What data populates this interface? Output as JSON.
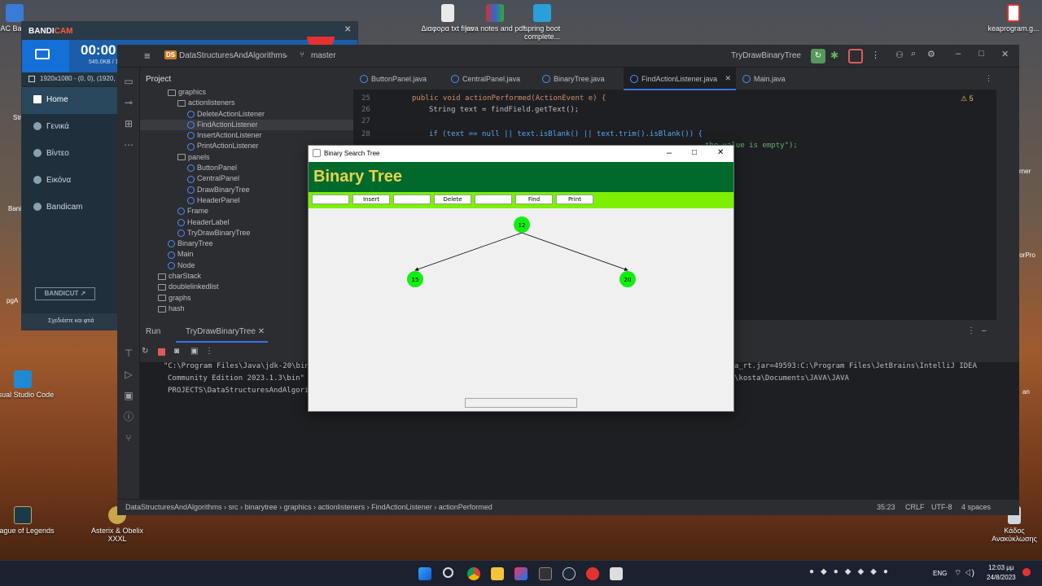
{
  "desktop": {
    "icons": [
      {
        "label": "AC Back"
      },
      {
        "label": "Διαφορα txt files"
      },
      {
        "label": "java notes and pdf"
      },
      {
        "label": "spring boot complete..."
      },
      {
        "label": "keaprogram.g..."
      },
      {
        "label": "Visual Studio Code"
      },
      {
        "label": "League of Legends"
      },
      {
        "label": "Asterix & Obelix XXXL"
      },
      {
        "label": "Κάδος Ανακύκλωσης"
      }
    ],
    "edge_labels": [
      "Str",
      "Bani",
      "pgA",
      "rner",
      "torPro",
      "an"
    ]
  },
  "bandicam": {
    "logo_a": "BANDI",
    "logo_b": "CAM",
    "timer": "00:00",
    "size": "545.0KB / 1",
    "resolution": "1920x1080 - (0, 0), (1920, 10",
    "menu": [
      "Home",
      "Γενικά",
      "Βίντεο",
      "Εικόνα",
      "Bandicam"
    ],
    "bandicut": "BANDICUT ↗",
    "footer": "Σχεδιάστε και φτιά"
  },
  "ide": {
    "project_badge": "DS",
    "project_name": "DataStructuresAndAlgorithms",
    "branch": "master",
    "run_config": "TryDrawBinaryTree",
    "panel_title": "Project",
    "tree": [
      {
        "label": "graphics",
        "kind": "folder",
        "indent": 3
      },
      {
        "label": "actionlisteners",
        "kind": "folder",
        "indent": 4
      },
      {
        "label": "DeleteActionListener",
        "kind": "class",
        "indent": 5
      },
      {
        "label": "FindActionListener",
        "kind": "class",
        "indent": 5,
        "selected": true
      },
      {
        "label": "InsertActionListener",
        "kind": "class",
        "indent": 5
      },
      {
        "label": "PrintActionListener",
        "kind": "class",
        "indent": 5
      },
      {
        "label": "panels",
        "kind": "folder",
        "indent": 4
      },
      {
        "label": "ButtonPanel",
        "kind": "class",
        "indent": 5
      },
      {
        "label": "CentralPanel",
        "kind": "class",
        "indent": 5
      },
      {
        "label": "DrawBinaryTree",
        "kind": "class",
        "indent": 5
      },
      {
        "label": "HeaderPanel",
        "kind": "class",
        "indent": 5
      },
      {
        "label": "Frame",
        "kind": "class",
        "indent": 4
      },
      {
        "label": "HeaderLabel",
        "kind": "class",
        "indent": 4
      },
      {
        "label": "TryDrawBinaryTree",
        "kind": "class",
        "indent": 4
      },
      {
        "label": "BinaryTree",
        "kind": "class",
        "indent": 3
      },
      {
        "label": "Main",
        "kind": "class",
        "indent": 3
      },
      {
        "label": "Node",
        "kind": "class",
        "indent": 3
      },
      {
        "label": "charStack",
        "kind": "folder",
        "indent": 2
      },
      {
        "label": "doublelinkedlist",
        "kind": "folder",
        "indent": 2
      },
      {
        "label": "graphs",
        "kind": "folder",
        "indent": 2
      },
      {
        "label": "hash",
        "kind": "folder",
        "indent": 2
      }
    ],
    "tabs": [
      {
        "label": "ButtonPanel.java"
      },
      {
        "label": "CentralPanel.java"
      },
      {
        "label": "BinaryTree.java"
      },
      {
        "label": "FindActionListener.java",
        "active": true
      },
      {
        "label": "Main.java"
      }
    ],
    "code": {
      "l25_num": "25",
      "l25": "public void actionPerformed(ActionEvent e) {",
      "l26_num": "26",
      "l26": "String text = findField.getText();",
      "l27_num": "27",
      "l28_num": "28",
      "l28": "if (text == null || text.isBlank() || text.trim().isBlank()) {",
      "l29_tail": "the value is empty\");",
      "warnings": "5"
    },
    "run": {
      "tab_run": "Run",
      "tab_config": "TryDrawBinaryTree",
      "out1a": "\"C:\\Program Files\\Java\\jdk-20\\bin",
      "out1b": "a_rt.jar=49593:C:\\Program Files\\JetBrains\\IntelliJ IDEA",
      "out2a": "Community Edition 2023.1.3\\bin\"",
      "out2b": "\\kosta\\Documents\\JAVA\\JAVA",
      "out3a": "PROJECTS\\DataStructuresAndAlgori"
    },
    "status": {
      "breadcrumb": [
        "DataStructuresAndAlgorithms",
        "src",
        "binarytree",
        "graphics",
        "actionlisteners",
        "FindActionListener",
        "actionPerformed"
      ],
      "position": "35:23",
      "line_sep": "CRLF",
      "encoding": "UTF-8",
      "indent": "4 spaces"
    }
  },
  "bst_window": {
    "title": "Binary Search Tree",
    "header": "Binary Tree",
    "buttons": {
      "insert": "Insert",
      "delete": "Delete",
      "find": "Find",
      "print": "Print"
    },
    "nodes": {
      "root": "12",
      "left": "15",
      "right": "20"
    },
    "node_color": "#11ee11",
    "header_bg": "#006a2c",
    "header_fg": "#e8d44d",
    "toolbar_bg": "#7cf000"
  },
  "taskbar": {
    "lang": "ENG",
    "time": "12:03 μμ",
    "date": "24/8/2023"
  }
}
